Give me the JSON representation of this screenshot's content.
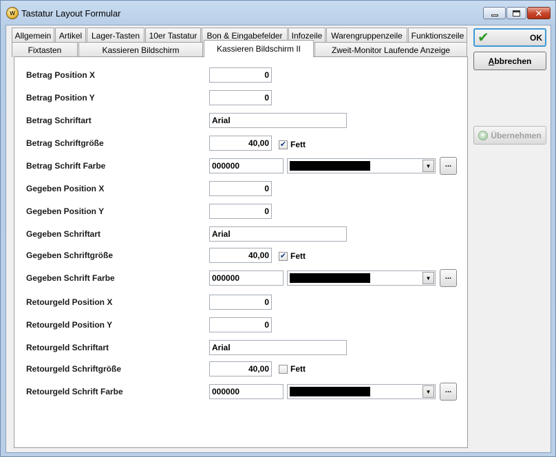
{
  "window": {
    "title": "Tastatur Layout Formular"
  },
  "tabs_row1": [
    "Allgemein",
    "Artikel",
    "Lager-Tasten",
    "10er Tastatur",
    "Bon & Eingabefelder",
    "Infozeile",
    "Warengruppenzeile",
    "Funktionszeile"
  ],
  "tabs_row2": [
    "Fixtasten",
    "Kassieren Bildschirm",
    "Kassieren Bildschirm II",
    "Zweit-Monitor Laufende Anzeige"
  ],
  "active_tab": "Kassieren Bildschirm II",
  "buttons": {
    "ok": "OK",
    "cancel_first": "A",
    "cancel_rest": "bbrechen",
    "apply": "Übernehmen",
    "dots": "..."
  },
  "fett_label": "Fett",
  "groups": [
    {
      "pos_x_label": "Betrag Position X",
      "pos_x": "0",
      "pos_y_label": "Betrag Position Y",
      "pos_y": "0",
      "font_label": "Betrag Schriftart",
      "font": "Arial",
      "size_label": "Betrag Schriftgröße",
      "size": "40,00",
      "bold": true,
      "color_label": "Betrag Schrift Farbe",
      "color": "000000",
      "swatch": "#000000"
    },
    {
      "pos_x_label": "Gegeben Position X",
      "pos_x": "0",
      "pos_y_label": "Gegeben Position Y",
      "pos_y": "0",
      "font_label": "Gegeben Schriftart",
      "font": "Arial",
      "size_label": "Gegeben Schriftgröße",
      "size": "40,00",
      "bold": true,
      "color_label": "Gegeben Schrift Farbe",
      "color": "000000",
      "swatch": "#000000"
    },
    {
      "pos_x_label": "Retourgeld Position X",
      "pos_x": "0",
      "pos_y_label": "Retourgeld Position Y",
      "pos_y": "0",
      "font_label": "Retourgeld Schriftart",
      "font": "Arial",
      "size_label": "Retourgeld Schriftgröße",
      "size": "40,00",
      "bold": false,
      "color_label": "Retourgeld Schrift Farbe",
      "color": "000000",
      "swatch": "#000000"
    }
  ]
}
